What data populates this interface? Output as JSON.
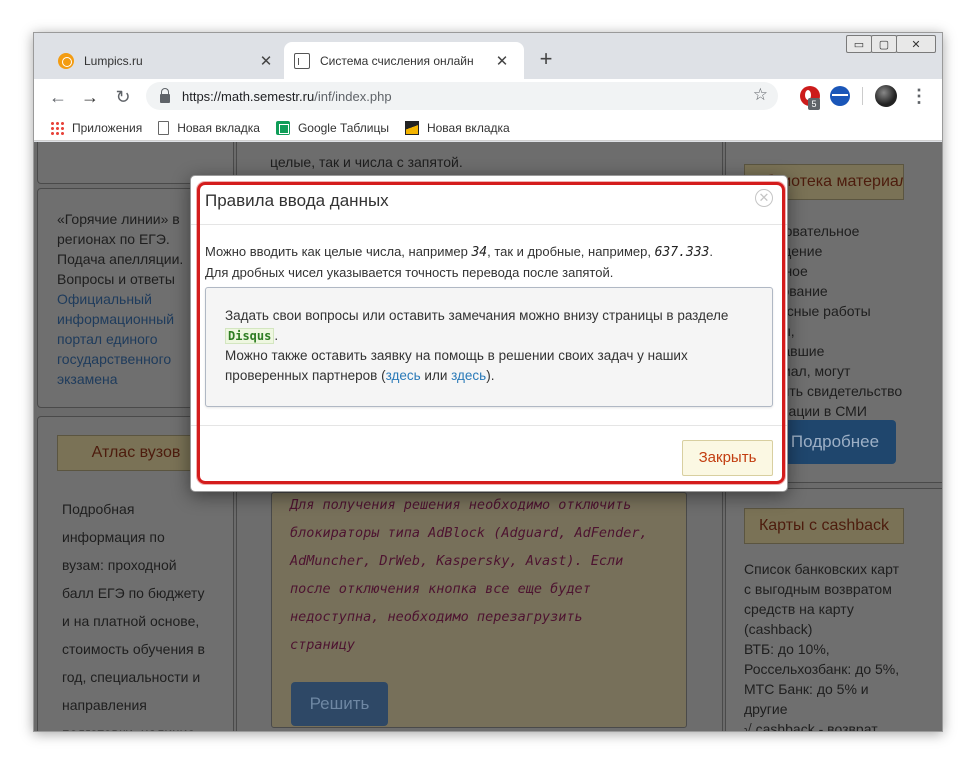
{
  "tabs": [
    {
      "title": "Lumpics.ru",
      "close": "✕"
    },
    {
      "title": "Система счисления онлайн",
      "close": "✕"
    }
  ],
  "new_tab": "+",
  "window_controls": {
    "min": "▭",
    "max": "▢",
    "close": "✕"
  },
  "toolbar": {
    "back": "←",
    "forward": "→",
    "reload": "↻",
    "url_host": "https://math.semestr.ru",
    "url_path": "/inf/index.php",
    "star": "☆",
    "ext_badge": "5",
    "menu": "⋮"
  },
  "bookmarks": [
    {
      "label": "Приложения",
      "icon": "apps-icon"
    },
    {
      "label": "Новая вкладка",
      "icon": "page-icon"
    },
    {
      "label": "Google Таблицы",
      "icon": "sheets-icon"
    },
    {
      "label": "Новая вкладка",
      "icon": "image-icon"
    }
  ],
  "background": {
    "top_text": "целые, так и числа с запятой.",
    "hotlines": {
      "text_lines": [
        "«Горячие линии» в",
        "регионах по ЕГЭ.",
        "Подача апелляции.",
        "Вопросы и ответы"
      ],
      "link_lines": [
        "Официальный",
        "информационный",
        "портал единого",
        "государственного",
        "экзамена"
      ]
    },
    "atlas": {
      "title": "Атлас вузов",
      "lines": [
        "Подробная",
        "информация по",
        "вузам: проходной",
        "балл ЕГЭ по бюджету",
        "и на платной основе,",
        "стоимость обучения в",
        "год, специальности и",
        "направления",
        "подготовки, наличие"
      ]
    },
    "library": {
      "title": "Библиотека материалов",
      "lines": [
        "Образовательное",
        "учреждение",
        "школьное",
        "образование",
        "конкурсные работы",
        "авторы,",
        "приславшие",
        "материал, могут",
        "получить свидетельство",
        "публикации в СМИ"
      ],
      "button": "Подробнее"
    },
    "cashback": {
      "title": "Карты с cashback",
      "lines": [
        "Список банковских карт",
        "с выгодным возвратом",
        "средств на карту",
        "(cashback)",
        "ВТБ: до 10%,",
        "Россельхозбанк: до 5%,",
        "МТС Банк: до 5% и",
        "другие",
        "√ cashback - возврат"
      ]
    },
    "notice_lines": [
      "Для получения решения необходимо отключить",
      "блокираторы типа AdBlock (Adguard, AdFender,",
      "AdMuncher, DrWeb, Kaspersky, Avast). Если",
      "после отключения кнопка все еще будет",
      "недоступна, необходимо перезагрузить",
      "страницу"
    ],
    "solve_button": "Решить"
  },
  "modal": {
    "title": "Правила ввода данных",
    "close_x": "✕",
    "line1_a": "Можно вводить как целые числа, например ",
    "line1_num1": "34",
    "line1_b": ", так и дробные, например, ",
    "line1_num2": "637.333",
    "line1_c": ".",
    "line2": "Для дробных чисел указывается точность перевода после запятой.",
    "inner_a": "Задать свои вопросы или оставить замечания можно внизу страницы в разделе",
    "inner_disqus": "Disqus",
    "inner_dot": ".",
    "inner_b": "Можно также оставить заявку на помощь в решении своих задач у наших",
    "inner_c": "проверенных партнеров (",
    "inner_link1": "здесь",
    "inner_or": " или ",
    "inner_link2": "здесь",
    "inner_end": ").",
    "close_button": "Закрыть"
  },
  "colors": {
    "highlight": "#d41c1c",
    "link": "#2a7ab8",
    "close_text": "#c23d10"
  }
}
